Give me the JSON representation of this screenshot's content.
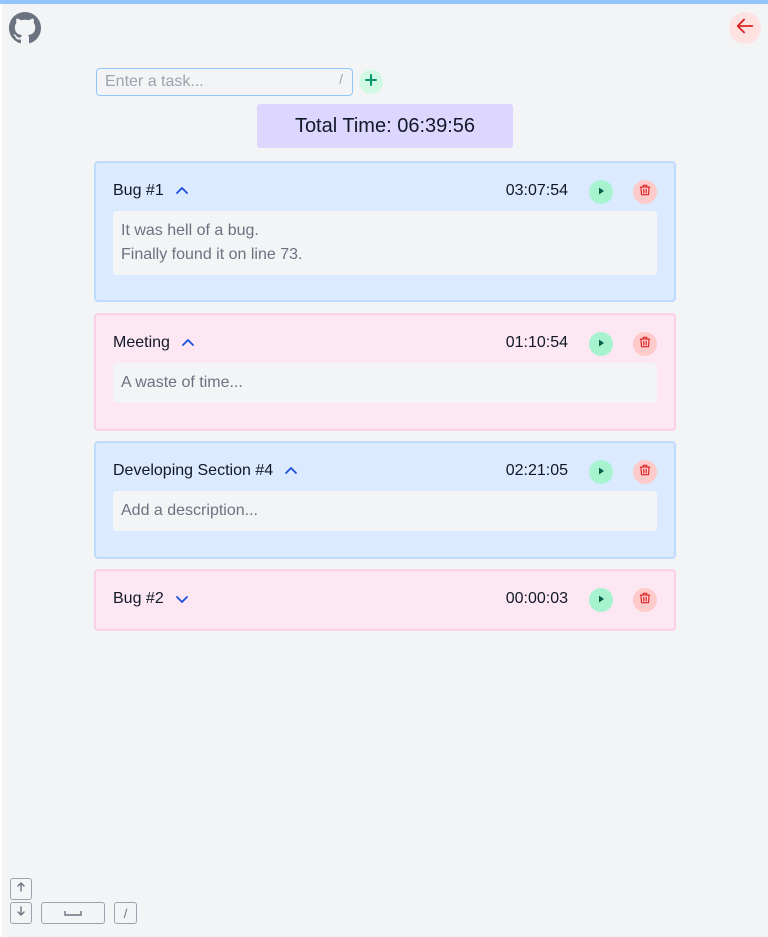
{
  "app": {
    "input_placeholder": "Enter a task...",
    "input_value": "",
    "input_shortcut": "/",
    "total_label": "Total Time: 06:39:56"
  },
  "tasks": [
    {
      "title": "Bug #1",
      "time": "03:07:54",
      "expanded": true,
      "color": "blue",
      "description": "It was hell of a bug.\nFinally found it on line 73."
    },
    {
      "title": "Meeting",
      "time": "01:10:54",
      "expanded": true,
      "color": "pink",
      "description": "A waste of time..."
    },
    {
      "title": "Developing Section #4",
      "time": "02:21:05",
      "expanded": true,
      "color": "blue",
      "description": "Add a description..."
    },
    {
      "title": "Bug #2",
      "time": "00:00:03",
      "expanded": false,
      "color": "pink",
      "description": ""
    }
  ],
  "shortcuts": {
    "slash": "/"
  },
  "colors": {
    "blue_card": "#dbeafe",
    "pink_card": "#fce7f3",
    "total_bg": "#ddd6fe",
    "play": "#a7f3d0",
    "delete": "#fecaca"
  },
  "icons": [
    "github-icon",
    "arrow-left-icon",
    "plus-icon",
    "chevron-up-icon",
    "chevron-down-icon",
    "play-icon",
    "trash-icon",
    "arrow-up-icon",
    "arrow-down-icon",
    "space-icon"
  ]
}
